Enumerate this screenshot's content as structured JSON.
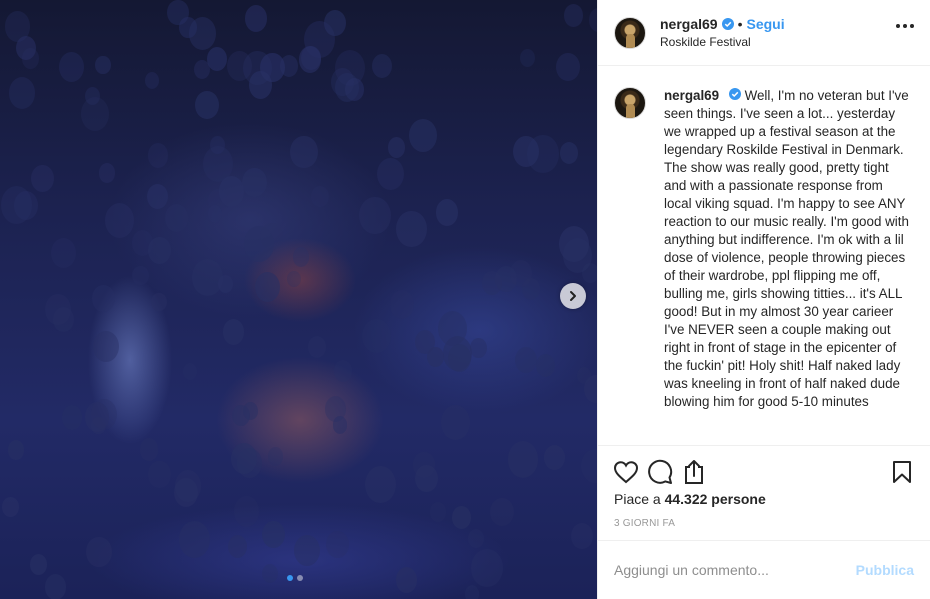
{
  "post": {
    "username": "nergal69",
    "follow_separator": "•",
    "follow_label": "Segui",
    "location": "Roskilde Festival",
    "caption": "Well, I'm no veteran but I've seen things. I've seen a lot... yesterday we wrapped up a festival season at the legendary Roskilde Festival in Denmark. The show was really good, pretty tight and with a passionate response from local viking squad. I'm happy to see ANY reaction to our music really. I'm good with anything but indifference. I'm ok with a lil dose of violence, people throwing pieces of their wardrobe, ppl flipping me off, bulling me, girls showing titties... it's ALL good! But in my almost 30 year carieer I've NEVER seen a couple making out right in front of stage in the epicenter of the fuckin' pit! Holy shit! Half naked lady was kneeling in front of half naked dude blowing him for good 5-10 minutes",
    "likes_prefix": "Piace a",
    "likes_count": "44.322 persone",
    "time_ago": "3 GIORNI FA",
    "comment_placeholder": "Aggiungi un commento...",
    "publish_label": "Pubblica"
  },
  "media": {
    "carousel_index": 1,
    "carousel_total": 2
  },
  "icons": {
    "verified": "verified-badge-icon",
    "more": "more-options-icon",
    "like": "heart-icon",
    "comment": "comment-icon",
    "share": "share-icon",
    "save": "bookmark-icon",
    "next": "chevron-right-icon"
  },
  "colors": {
    "accent": "#3897f0",
    "publish_disabled": "#b3dbff",
    "muted": "#999999"
  }
}
